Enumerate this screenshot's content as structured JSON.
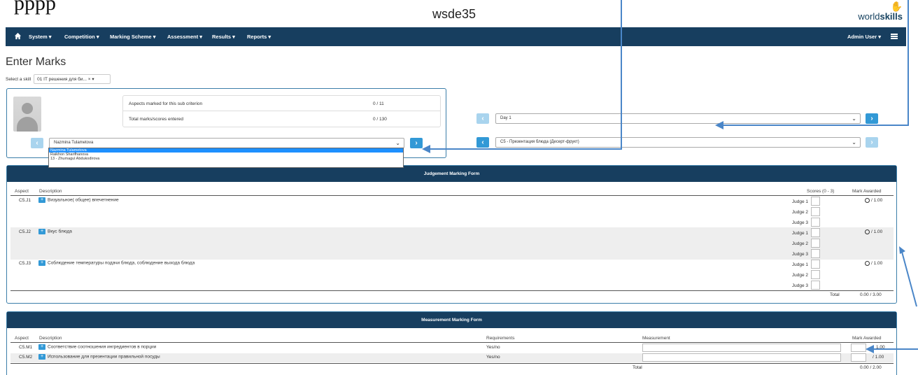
{
  "site": {
    "title": "wsde35",
    "logo_text_regular": "world",
    "logo_text_bold": "skills",
    "top_crop_text": "рррр"
  },
  "nav": {
    "items": [
      "System ▾",
      "Competition ▾",
      "Marking Scheme ▾",
      "Assessment ▾",
      "Results ▾",
      "Reports ▾"
    ],
    "user": "Admin User ▾"
  },
  "page": {
    "title": "Enter Marks"
  },
  "skill": {
    "label": "Select a skill",
    "value": "01 IT решения для би... × ▾"
  },
  "stats": {
    "aspects_label": "Aspects marked for this sub criterion",
    "aspects_value": "0 / 11",
    "total_label": "Total marks/scores entered",
    "total_value": "0 / 130"
  },
  "competitor": {
    "selected": "Nazmina Tulametova",
    "options": [
      "Nazmina Tulametova",
      "Raikhon Sharifhanova",
      "13 - Zhumagul Abdukodirova"
    ]
  },
  "day": {
    "selected": "Day 1"
  },
  "subcriterion": {
    "selected": "C5 - Презентация блюда (Десерт-фрукт)"
  },
  "judgement": {
    "title": "Judgement Marking Form",
    "headers": {
      "aspect": "Aspect",
      "description": "Description",
      "scores": "Scores (0 - 3)",
      "mark": "Mark Awarded"
    },
    "rows": [
      {
        "aspect": "C5.J1",
        "description": "Визуальное( общее) впечетнение",
        "mark": "/ 1.00"
      },
      {
        "aspect": "C5.J2",
        "description": "Вкус блюда",
        "mark": "/ 1.00"
      },
      {
        "aspect": "C5.J3",
        "description": "Соблюдение температуры подачи блюда, соблюдение выхода блюда",
        "mark": "/ 1.00"
      }
    ],
    "judges": [
      "Judge 1",
      "Judge 2",
      "Judge 3"
    ],
    "total_label": "Total",
    "total_value": "0.00 / 3.00"
  },
  "measurement": {
    "title": "Measurement Marking Form",
    "headers": {
      "aspect": "Aspect",
      "description": "Description",
      "requirements": "Requirements",
      "measurement": "Measurement",
      "mark": "Mark Awarded"
    },
    "rows": [
      {
        "aspect": "C5.M1",
        "description": "Соответствие соотношения ингредиентов в порции",
        "requirements": "Yes/no",
        "mark": "1.00"
      },
      {
        "aspect": "C5.M2",
        "description": "Использование для презентации правильной посуды",
        "requirements": "Yes/no",
        "mark": "/ 1.00"
      }
    ],
    "total_label": "Total",
    "total_value": "0.00 / 2.00"
  },
  "colors": {
    "navbar": "#173e5f",
    "accent": "#3299d6",
    "border": "#3b7ea9"
  }
}
